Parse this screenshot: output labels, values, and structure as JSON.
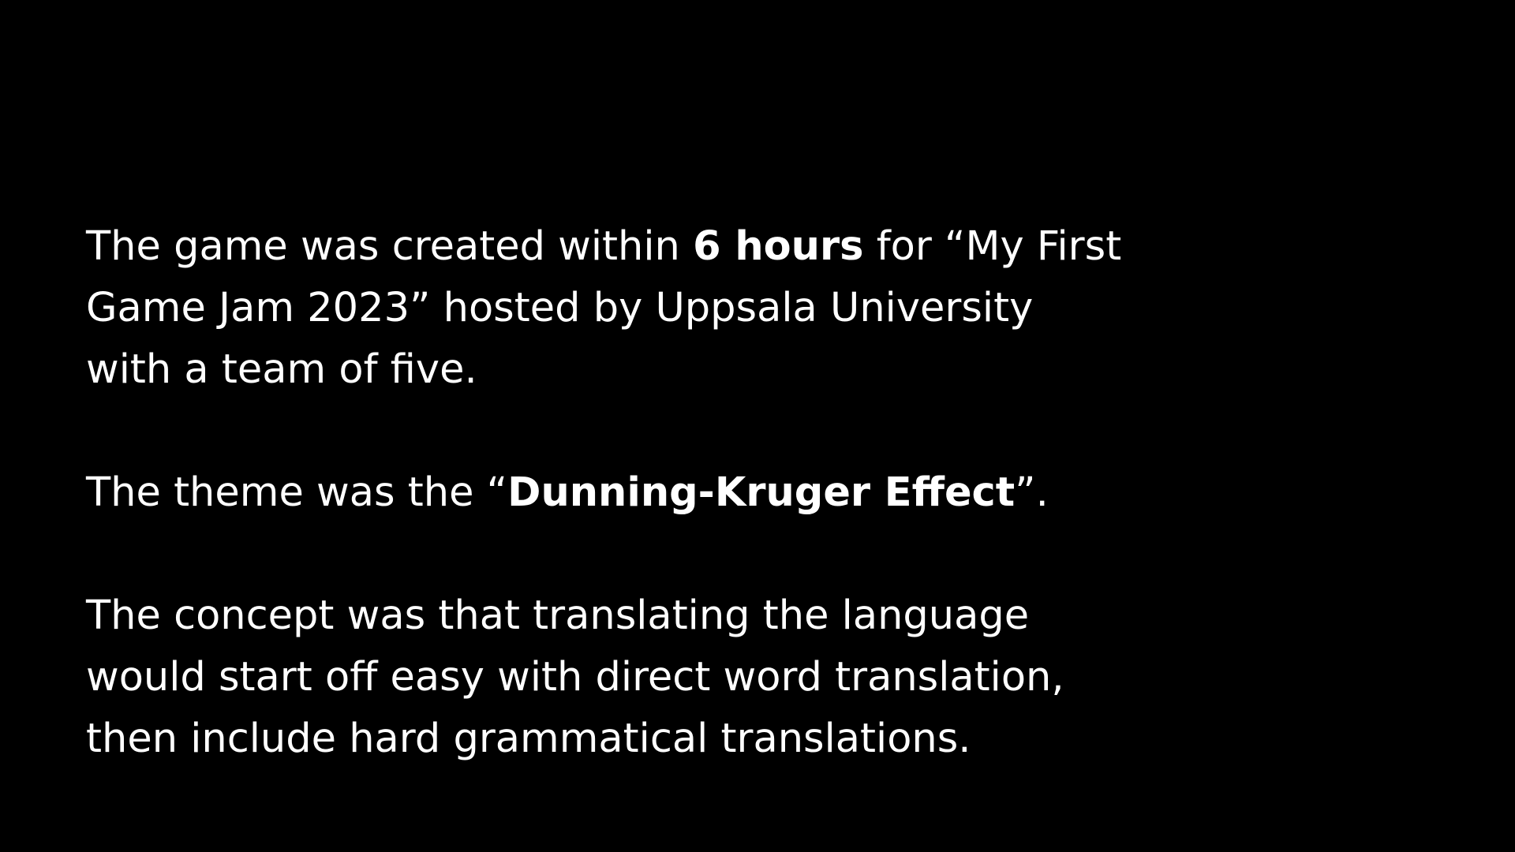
{
  "slide": {
    "background_color": "#000000",
    "text_color": "#ffffff",
    "paragraphs": [
      {
        "part1": "The game was created within ",
        "bold1": "6 hours",
        "part2": " for “My First Game Jam 2023” hosted by Uppsala University with a team of five."
      },
      {
        "part1": "The theme was the “",
        "bold1": "Dunning-Kruger Effect",
        "part2": "”."
      },
      {
        "text": "The concept was that translating the language would start off easy with direct word translation, then include hard grammatical translations."
      }
    ]
  }
}
